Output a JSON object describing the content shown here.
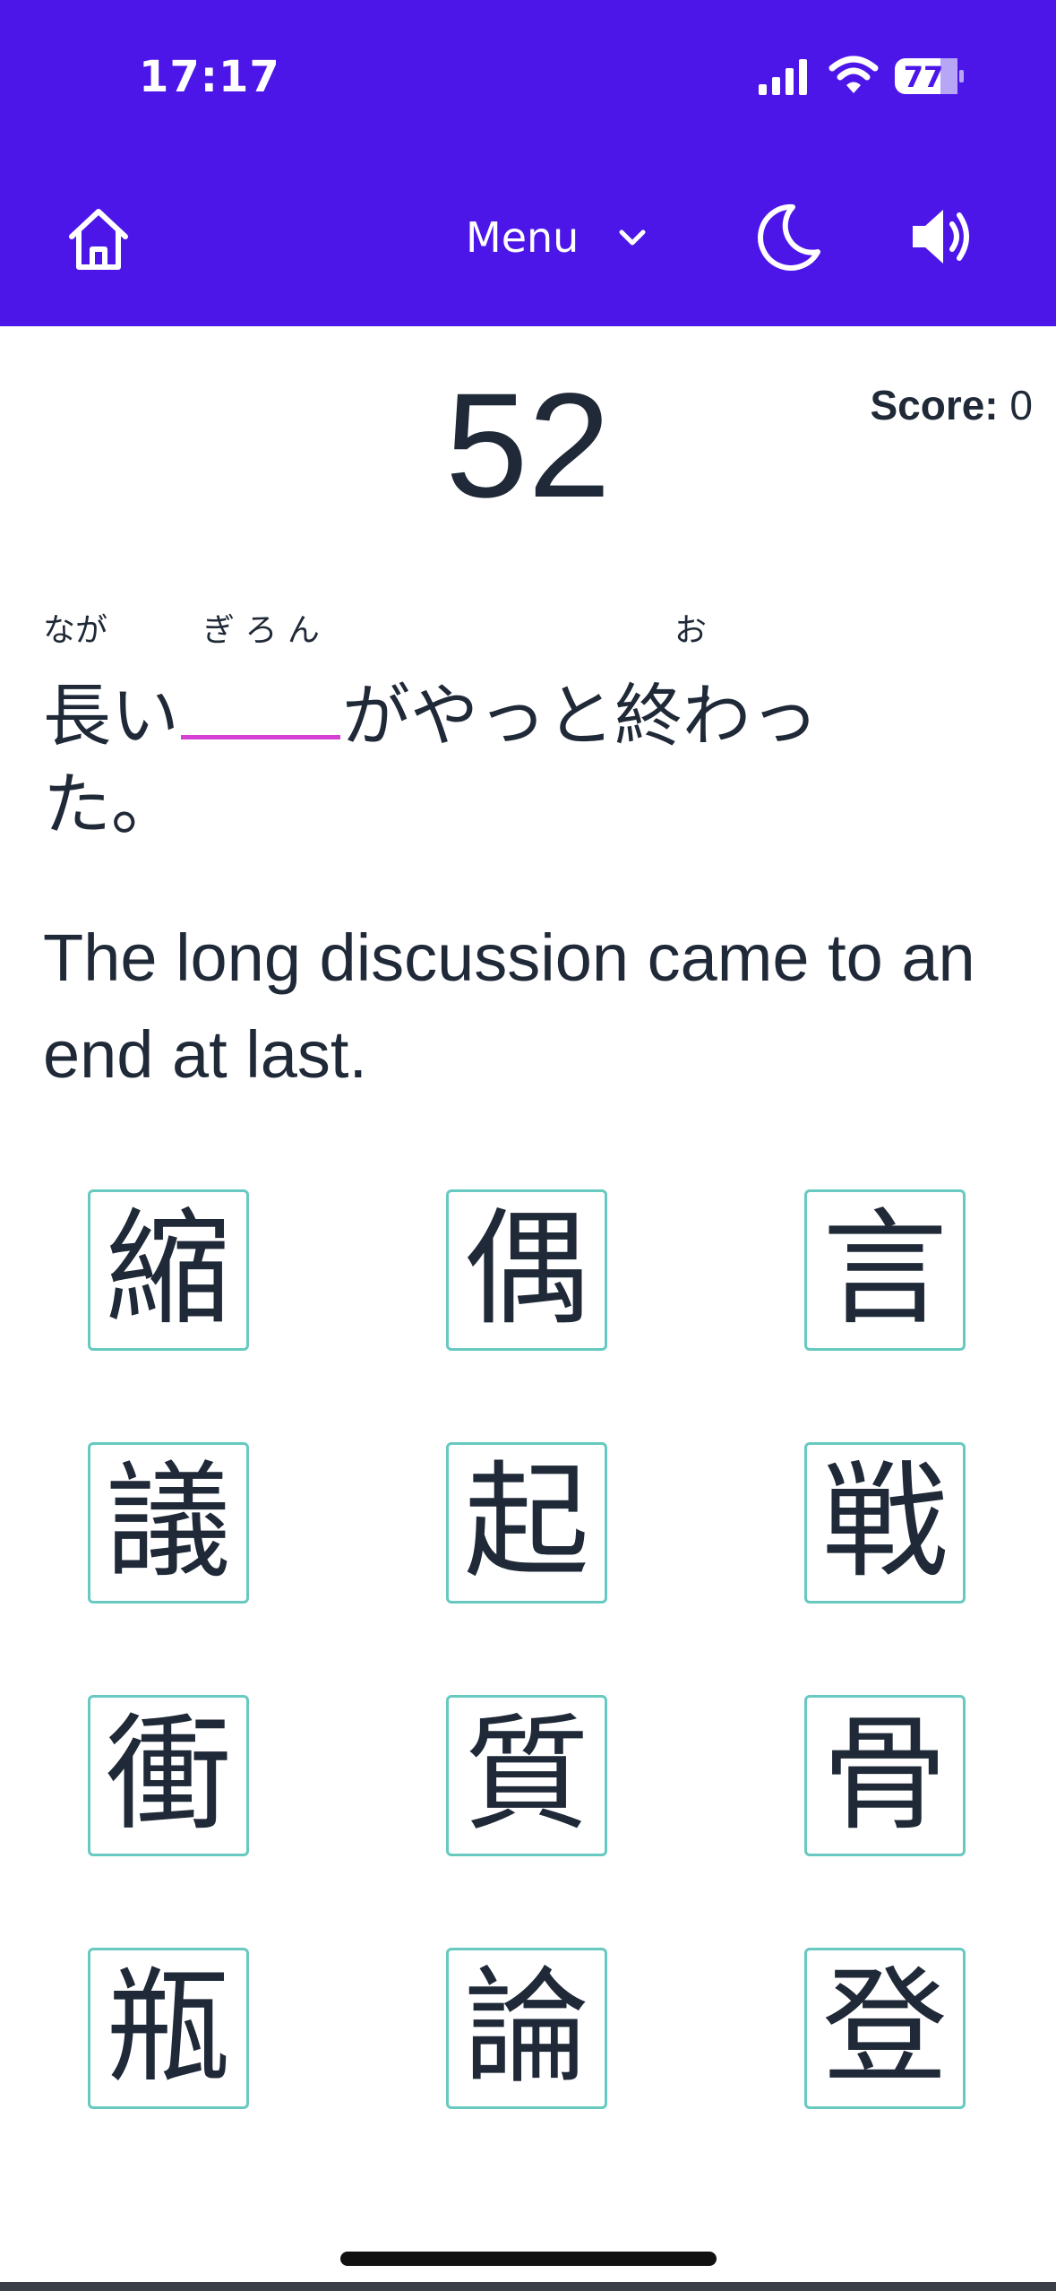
{
  "status_bar": {
    "time": "17:17",
    "battery": "77",
    "signal_icon": "signal-icon",
    "wifi_icon": "wifi-icon"
  },
  "nav": {
    "menu_label": "Menu"
  },
  "quiz": {
    "counter": "52",
    "score_label": "Score:",
    "score_value": "0",
    "furigana": {
      "naga": "なが",
      "giron": "ぎ ろ ん",
      "o": "お"
    },
    "jp_line1_a": "長い",
    "jp_line1_b": "がやっと終わっ",
    "jp_line2": "た。",
    "english": "The long discussion came to an end at last."
  },
  "choices": [
    "縮",
    "偶",
    "言",
    "議",
    "起",
    "戦",
    "衝",
    "質",
    "骨",
    "瓶",
    "論",
    "登"
  ],
  "colors": {
    "header": "#4c16e8",
    "blank_underline": "#d53fd2",
    "card_border": "#67c9c0",
    "text": "#1f2937"
  }
}
